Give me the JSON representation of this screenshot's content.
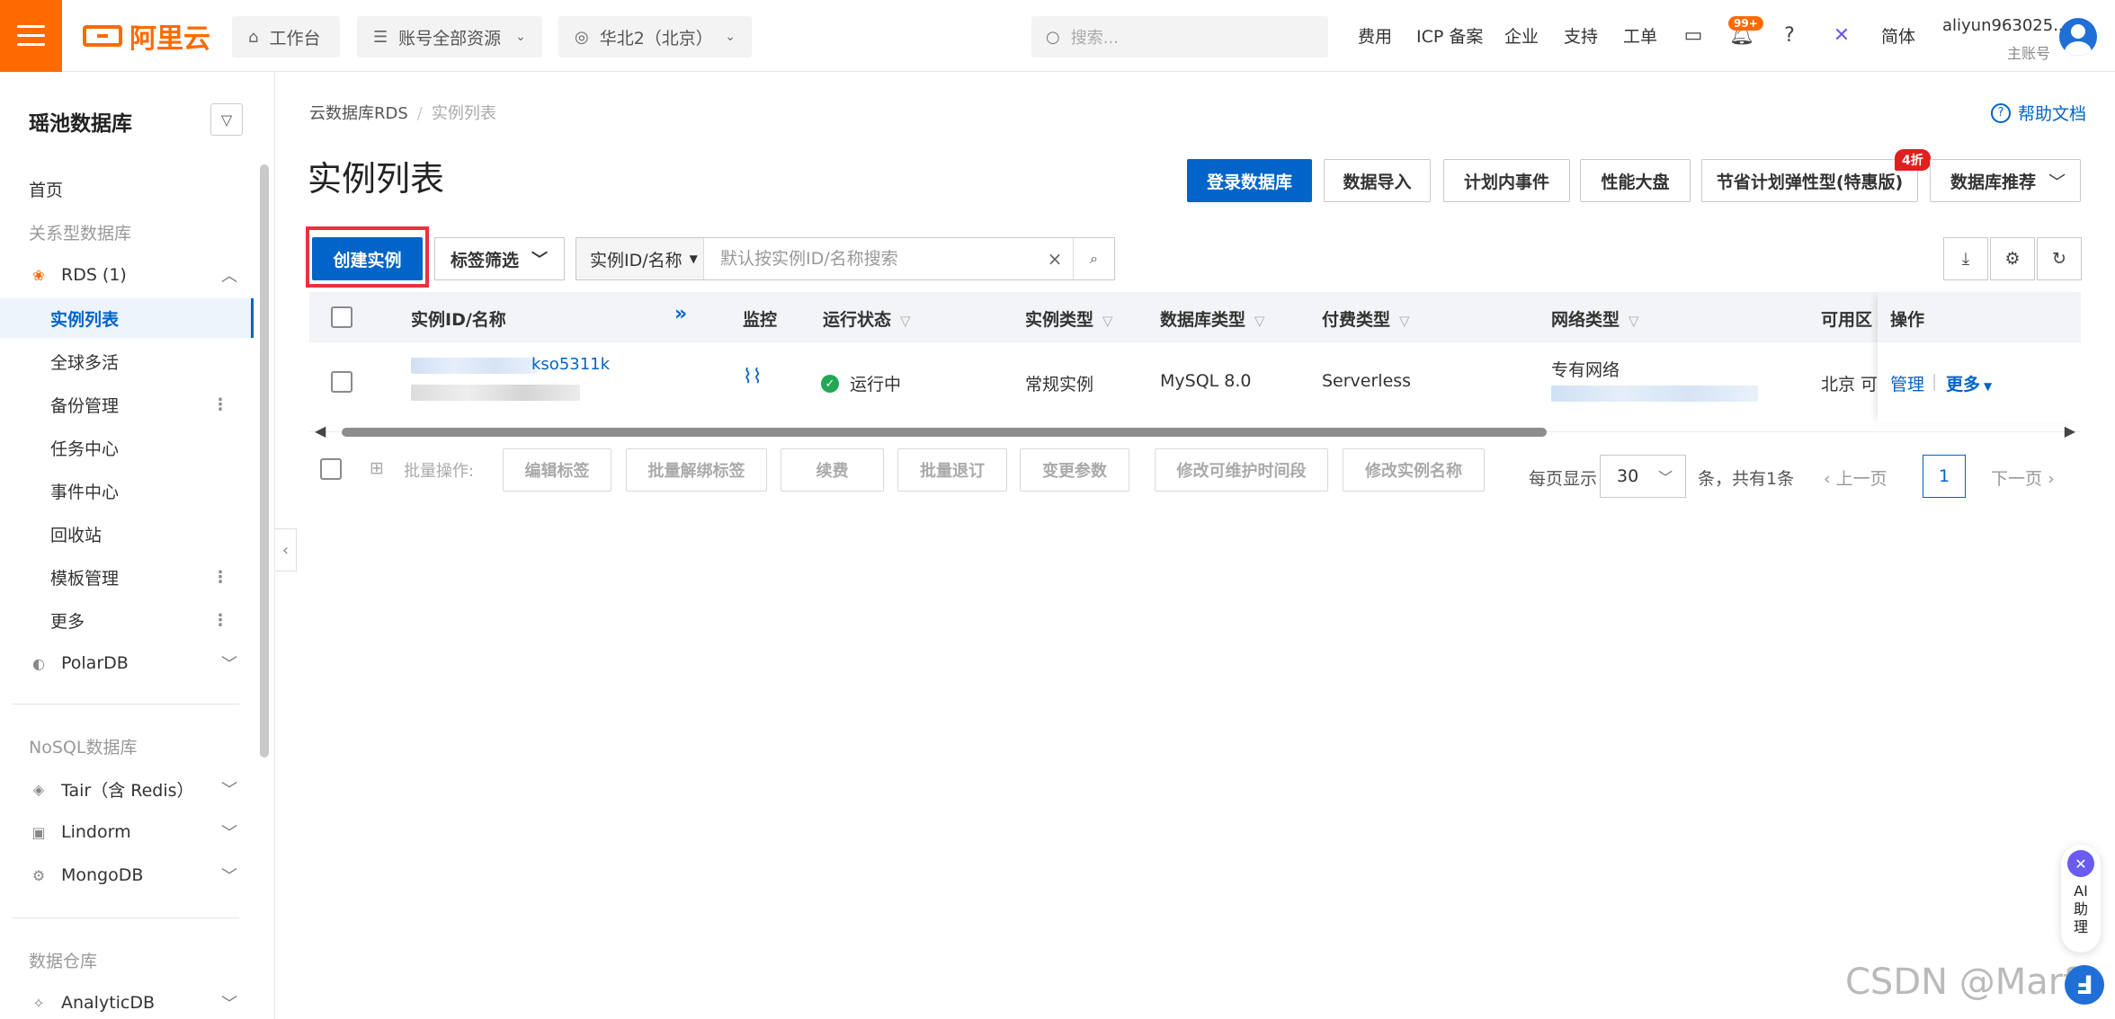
{
  "topbar": {
    "logo_text": "阿里云",
    "workbench": "工作台",
    "resource_scope": "账号全部资源",
    "region": "华北2（北京）",
    "search_placeholder": "搜索...",
    "links": [
      "费用",
      "ICP 备案",
      "企业",
      "支持",
      "工单"
    ],
    "notification_count": "99+",
    "language": "简体",
    "user_name": "aliyun963025...",
    "user_role": "主账号"
  },
  "sidebar": {
    "title": "瑶池数据库",
    "items": [
      {
        "label": "首页",
        "type": "item"
      },
      {
        "label": "关系型数据库",
        "type": "group"
      },
      {
        "label": "RDS (1)",
        "type": "product",
        "icon": "rds-icon",
        "expanded": true
      },
      {
        "label": "实例列表",
        "type": "sub",
        "active": true
      },
      {
        "label": "全球多活",
        "type": "sub"
      },
      {
        "label": "备份管理",
        "type": "sub",
        "more": true
      },
      {
        "label": "任务中心",
        "type": "sub"
      },
      {
        "label": "事件中心",
        "type": "sub"
      },
      {
        "label": "回收站",
        "type": "sub"
      },
      {
        "label": "模板管理",
        "type": "sub",
        "more": true
      },
      {
        "label": "更多",
        "type": "sub",
        "more": true
      },
      {
        "label": "PolarDB",
        "type": "product",
        "icon": "polardb-icon"
      },
      {
        "label": "NoSQL数据库",
        "type": "group"
      },
      {
        "label": "Tair（含 Redis）",
        "type": "product",
        "icon": "tair-icon"
      },
      {
        "label": "Lindorm",
        "type": "product",
        "icon": "lindorm-icon"
      },
      {
        "label": "MongoDB",
        "type": "product",
        "icon": "mongodb-icon"
      },
      {
        "label": "数据仓库",
        "type": "group"
      },
      {
        "label": "AnalyticDB",
        "type": "product",
        "icon": "analyticdb-icon"
      }
    ]
  },
  "main": {
    "breadcrumb": [
      "云数据库RDS",
      "实例列表"
    ],
    "help_doc": "帮助文档",
    "title": "实例列表",
    "actions": {
      "login_db": "登录数据库",
      "data_import": "数据导入",
      "planned_events": "计划内事件",
      "perf_dashboard": "性能大盘",
      "savings_plan": "节省计划弹性型(特惠版)",
      "discount_badge": "4折",
      "db_recommend": "数据库推荐"
    },
    "toolbar": {
      "create_instance": "创建实例",
      "tag_filter": "标签筛选",
      "search_type": "实例ID/名称",
      "search_placeholder": "默认按实例ID/名称搜索"
    },
    "table": {
      "columns": [
        "实例ID/名称",
        "监控",
        "运行状态",
        "实例类型",
        "数据库类型",
        "付费类型",
        "网络类型",
        "可用区",
        "操作"
      ],
      "rows": [
        {
          "instance_id_suffix": "kso5311k",
          "status": "运行中",
          "instance_type": "常规实例",
          "db_type": "MySQL 8.0",
          "pay_type": "Serverless",
          "network_type": "专有网络",
          "zone": "北京 可月",
          "op_manage": "管理",
          "op_more": "更多"
        }
      ]
    },
    "batch": {
      "label": "批量操作:",
      "buttons": [
        "编辑标签",
        "批量解绑标签",
        "续费",
        "批量退订",
        "变更参数",
        "修改可维护时间段",
        "修改实例名称"
      ]
    },
    "pagination": {
      "per_page_label": "每页显示",
      "per_page": "30",
      "total": "条，共有1条",
      "prev": "上一页",
      "current": "1",
      "next": "下一页"
    }
  },
  "ai_assistant": {
    "label": "AI助理"
  },
  "watermark": "CSDN @Marf"
}
